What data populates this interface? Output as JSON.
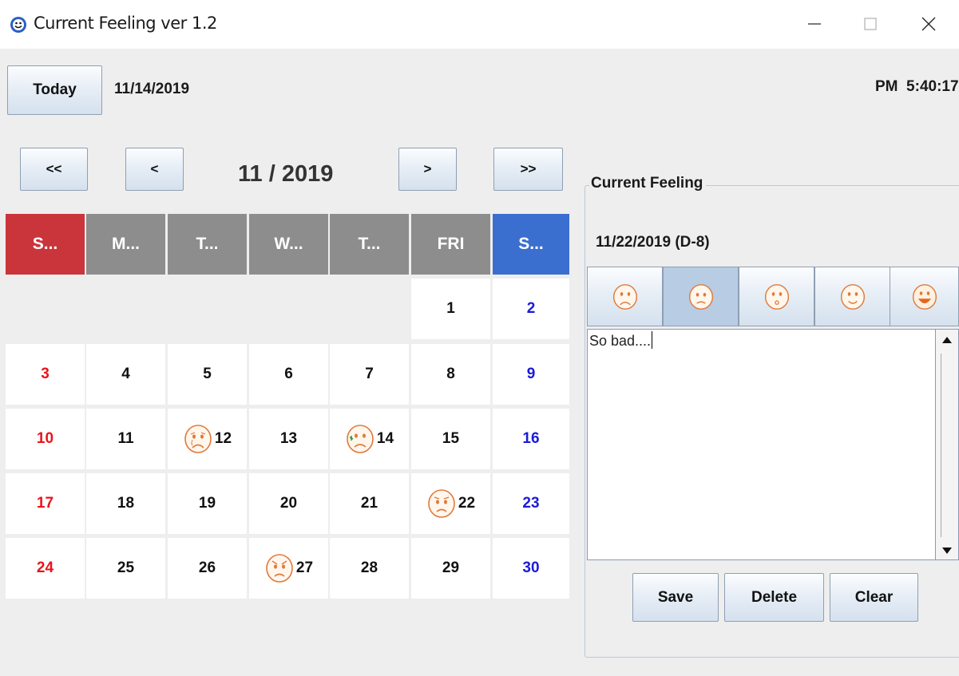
{
  "window": {
    "title": "Current Feeling ver 1.2",
    "controls": {
      "minimize": "−",
      "maximize": "□",
      "close": "✕"
    }
  },
  "toolbar": {
    "today_label": "Today",
    "today_date": "11/14/2019",
    "clock": "PM  5:40:17"
  },
  "calendar": {
    "nav": {
      "prev_year": "<<",
      "prev_month": "<",
      "next_month": ">",
      "next_year": ">>"
    },
    "month_label": "11 / 2019",
    "weekdays": [
      "S...",
      "M...",
      "T...",
      "W...",
      "T...",
      "FRI",
      "S..."
    ],
    "weekday_colors": [
      "#c9353a",
      "#8d8d8d",
      "#8d8d8d",
      "#8d8d8d",
      "#8d8d8d",
      "#8d8d8d",
      "#3b6fcf"
    ],
    "days": {
      "d1": "1",
      "d2": "2",
      "d3": "3",
      "d4": "4",
      "d5": "5",
      "d6": "6",
      "d7": "7",
      "d8": "8",
      "d9": "9",
      "d10": "10",
      "d11": "11",
      "d12": "12",
      "d13": "13",
      "d14": "14",
      "d15": "15",
      "d16": "16",
      "d17": "17",
      "d18": "18",
      "d19": "19",
      "d20": "20",
      "d21": "21",
      "d22": "22",
      "d23": "23",
      "d24": "24",
      "d25": "25",
      "d26": "26",
      "d27": "27",
      "d28": "28",
      "d29": "29",
      "d30": "30"
    },
    "day_faces": {
      "12": "crying-face-icon",
      "14": "sick-face-icon",
      "22": "sad-face-icon",
      "27": "angry-face-icon"
    }
  },
  "feeling_panel": {
    "title": "Current Feeling",
    "date_label": "11/22/2019 (D-8)",
    "moods": [
      "very-bad-face-icon",
      "bad-face-icon",
      "neutral-face-icon",
      "good-face-icon",
      "very-good-face-icon"
    ],
    "selected_mood_index": 1,
    "note": "So bad....",
    "buttons": {
      "save": "Save",
      "delete": "Delete",
      "clear": "Clear"
    }
  },
  "colors": {
    "sunday": "#e8141c",
    "saturday": "#1a1ad8",
    "face_orange": "#e07a3c"
  }
}
